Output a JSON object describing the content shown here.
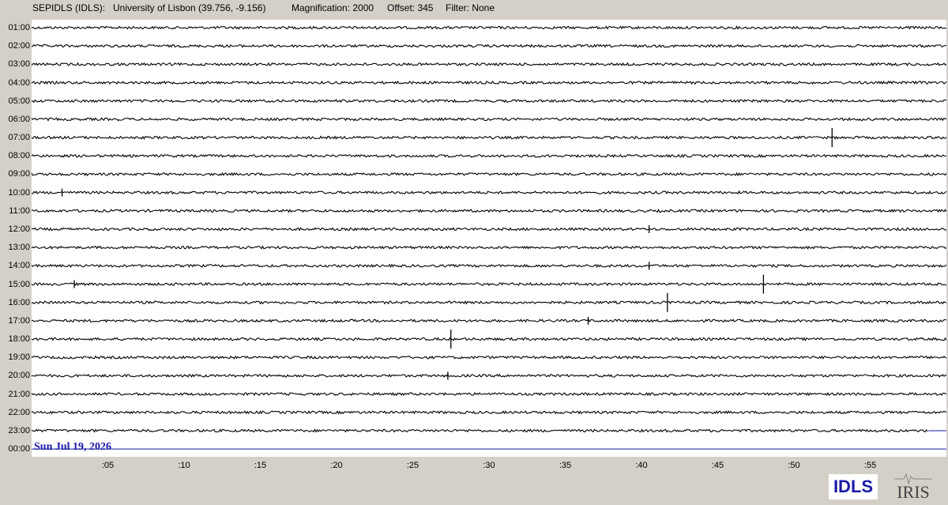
{
  "header": {
    "station": "SEPIDLS (IDLS):",
    "location": "University of Lisbon (39.756, -9.156)",
    "magnification": "Magnification: 2000",
    "offset": "Offset: 345",
    "filter": "Filter: None"
  },
  "date_label": "Sun Jul 19, 2026",
  "hour_labels": [
    "01:00",
    "02:00",
    "03:00",
    "04:00",
    "05:00",
    "06:00",
    "07:00",
    "08:00",
    "09:00",
    "10:00",
    "11:00",
    "12:00",
    "13:00",
    "14:00",
    "15:00",
    "16:00",
    "17:00",
    "18:00",
    "19:00",
    "20:00",
    "21:00",
    "22:00",
    "23:00",
    "00:00"
  ],
  "minute_labels": [
    ":05",
    ":10",
    ":15",
    ":20",
    ":25",
    ":30",
    ":35",
    ":40",
    ":45",
    ":50",
    ":55"
  ],
  "logos": {
    "idls": "IDLS",
    "iris": "IRIS"
  },
  "colors": {
    "trace": "#000000",
    "current_hour_line": "#1a1aa6",
    "date_text": "#1a1aa6",
    "background": "#d4d0c8"
  },
  "chart_data": {
    "type": "line",
    "x_range_minutes": [
      0,
      60
    ],
    "partial_trace_end_minute": 58.8,
    "events": [
      {
        "hour": "07:00",
        "minute": 52.5,
        "amplitude": "large"
      },
      {
        "hour": "15:00",
        "minute": 48,
        "amplitude": "large"
      },
      {
        "hour": "16:00",
        "minute": 41.7,
        "amplitude": "large"
      },
      {
        "hour": "18:00",
        "minute": 27.5,
        "amplitude": "large"
      },
      {
        "hour": "10:00",
        "minute": 2,
        "amplitude": "small"
      },
      {
        "hour": "12:00",
        "minute": 40.5,
        "amplitude": "small"
      },
      {
        "hour": "14:00",
        "minute": 40.5,
        "amplitude": "small"
      },
      {
        "hour": "15:00",
        "minute": 2.8,
        "amplitude": "small"
      },
      {
        "hour": "17:00",
        "minute": 36.5,
        "amplitude": "small"
      },
      {
        "hour": "20:00",
        "minute": 27.3,
        "amplitude": "small"
      }
    ]
  }
}
